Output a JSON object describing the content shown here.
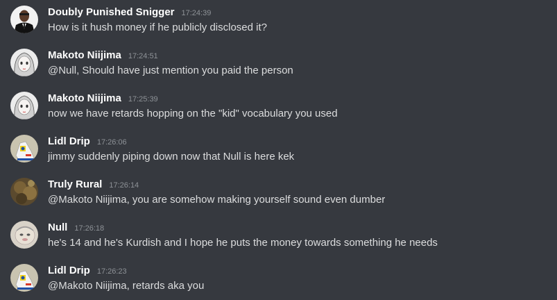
{
  "messages": [
    {
      "author": "Doubly Punished Snigger",
      "time": "17:24:39",
      "text": "How is it hush money if he publicly disclosed it?",
      "avatar": "photo-avatar-man-in-suit"
    },
    {
      "author": "Makoto Niijima",
      "time": "17:24:51",
      "text": "@Null, Should have just mention you paid the person",
      "avatar": "manga-avatar-girl"
    },
    {
      "author": "Makoto Niijima",
      "time": "17:25:39",
      "text": "now we have retards hopping on the \"kid\" vocabulary you used",
      "avatar": "manga-avatar-girl"
    },
    {
      "author": "Lidl Drip",
      "time": "17:26:06",
      "text": "jimmy suddenly piping down now that Null is here kek",
      "avatar": "lidl-sneaker-avatar"
    },
    {
      "author": "Truly Rural",
      "time": "17:26:14",
      "text": "@Makoto Niijima, you are somehow making yourself sound even dumber",
      "avatar": "rural-brown-avatar"
    },
    {
      "author": "Null",
      "time": "17:26:18",
      "text": "he's 14 and he's Kurdish and I hope he puts the money towards something he needs",
      "avatar": "cartoon-face-avatar"
    },
    {
      "author": "Lidl Drip",
      "time": "17:26:23",
      "text": "@Makoto Niijima, retards aka you",
      "avatar": "lidl-sneaker-avatar"
    }
  ],
  "colors": {
    "background": "#36393f",
    "author": "#ffffff",
    "timestamp": "#8e9297",
    "text": "#dcddde"
  }
}
